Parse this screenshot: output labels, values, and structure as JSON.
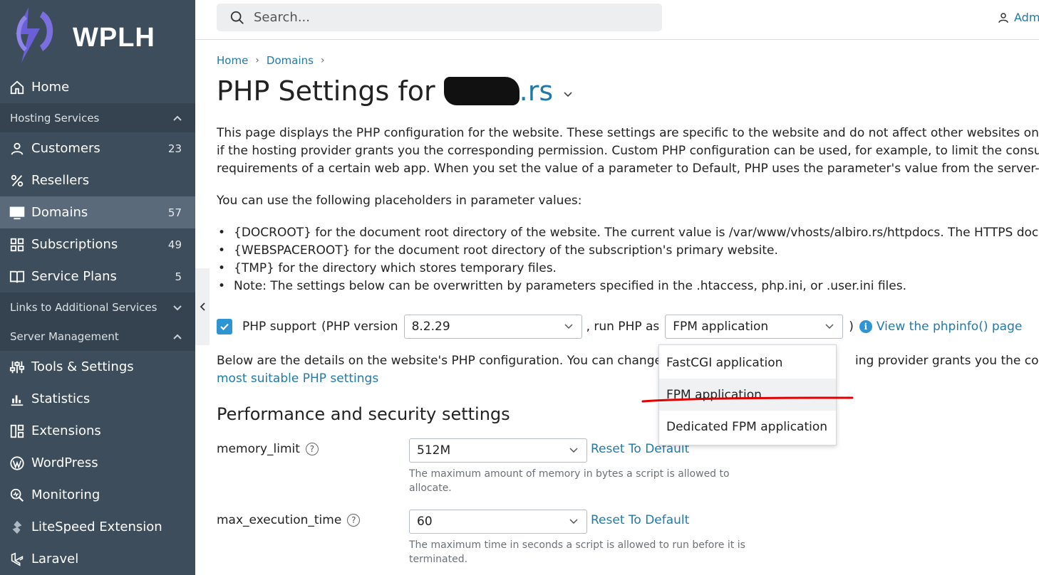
{
  "sidebar": {
    "logo_text": "WPLH",
    "items": [
      {
        "label": "Home",
        "count": ""
      },
      {
        "label": "Customers",
        "count": "23"
      },
      {
        "label": "Resellers",
        "count": ""
      },
      {
        "label": "Domains",
        "count": "57"
      },
      {
        "label": "Subscriptions",
        "count": "49"
      },
      {
        "label": "Service Plans",
        "count": "5"
      },
      {
        "label": "Tools & Settings",
        "count": ""
      },
      {
        "label": "Statistics",
        "count": ""
      },
      {
        "label": "Extensions",
        "count": ""
      },
      {
        "label": "WordPress",
        "count": ""
      },
      {
        "label": "Monitoring",
        "count": ""
      },
      {
        "label": "LiteSpeed Extension",
        "count": ""
      },
      {
        "label": "Laravel",
        "count": ""
      }
    ],
    "sections": {
      "hosting": "Hosting Services",
      "links": "Links to Additional Services",
      "server": "Server Management"
    },
    "active_item": "Domains"
  },
  "topbar": {
    "search_placeholder": "Search...",
    "user_label": "Adm"
  },
  "breadcrumb": [
    "Home",
    "Domains"
  ],
  "page": {
    "title_prefix": "PHP Settings for",
    "domain_suffix": ".rs",
    "intro_lines": [
      "This page displays the PHP configuration for the website. These settings are specific to the website and do not affect other websites on the sub",
      "if the hosting provider grants you the corresponding permission. Custom PHP configuration can be used, for example, to limit the consumptio",
      "requirements of a certain web app. When you set the value of a parameter to Default, PHP uses the parameter's value from the server-wide Pl"
    ],
    "placeholders_intro": "You can use the following placeholders in parameter values:",
    "bullets": [
      "{DOCROOT} for the document root directory of the website. The current value is /var/www/vhosts/albiro.rs/httpdocs. The HTTPS document",
      "{WEBSPACEROOT} for the document root directory of the subscription's primary website.",
      "{TMP} for the directory which stores temporary files.",
      "Note: The settings below can be overwritten by parameters specified in the .htaccess, php.ini, or .user.ini files."
    ]
  },
  "php_row": {
    "checkbox_checked": true,
    "support_label": "PHP support",
    "version_prefix": "(PHP version",
    "version_value": "8.2.29",
    "run_as_label": ", run PHP as",
    "run_as_value": "FPM application",
    "close_paren": ")",
    "phpinfo_link": "View the phpinfo() page"
  },
  "run_as_options": [
    "FastCGI application",
    "FPM application",
    "Dedicated FPM application"
  ],
  "details": {
    "line1_start": "Below are the details on the website's PHP configuration. You can change th",
    "line1_end": "ing provider grants you the corresp",
    "line2_link": "most suitable PHP settings"
  },
  "performance": {
    "heading": "Performance and security settings",
    "reset_label": "Reset To Default",
    "params": [
      {
        "name": "memory_limit",
        "value": "512M",
        "hint": "The maximum amount of memory in bytes a script is allowed to allocate."
      },
      {
        "name": "max_execution_time",
        "value": "60",
        "hint": "The maximum time in seconds a script is allowed to run before it is terminated."
      }
    ]
  },
  "colors": {
    "sidebar_bg": "#3d4d5c",
    "accent": "#2d95d3",
    "link": "#1f7aa8",
    "annotation": "#e00000"
  }
}
